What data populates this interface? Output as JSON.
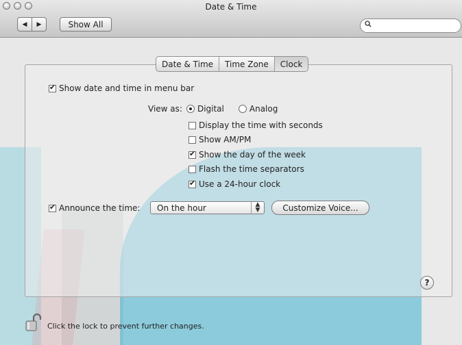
{
  "window": {
    "title": "Date & Time"
  },
  "toolbar": {
    "back_label": "◀",
    "forward_label": "▶",
    "show_all_label": "Show All"
  },
  "search": {
    "value": "",
    "placeholder": ""
  },
  "tabs": [
    {
      "label": "Date & Time",
      "selected": false
    },
    {
      "label": "Time Zone",
      "selected": false
    },
    {
      "label": "Clock",
      "selected": true
    }
  ],
  "clock": {
    "show_in_menu_bar": {
      "label": "Show date and time in menu bar",
      "checked": true
    },
    "view_as": {
      "label": "View as:",
      "options": [
        {
          "label": "Digital",
          "selected": true
        },
        {
          "label": "Analog",
          "selected": false
        }
      ]
    },
    "options": [
      {
        "label": "Display the time with seconds",
        "checked": false
      },
      {
        "label": "Show AM/PM",
        "checked": false
      },
      {
        "label": "Show the day of the week",
        "checked": true
      },
      {
        "label": "Flash the time separators",
        "checked": false
      },
      {
        "label": "Use a 24-hour clock",
        "checked": true
      }
    ],
    "announce": {
      "label": "Announce the time:",
      "checked": true,
      "selected_value": "On the hour",
      "customize_label": "Customize Voice..."
    }
  },
  "help": {
    "label": "?"
  },
  "lock": {
    "text": "Click the lock to prevent further changes."
  },
  "colors": {
    "accent_overlay": "#3fb3cf"
  },
  "icons": {
    "search": "search-icon",
    "lock": "lock-open-icon",
    "help": "help-icon"
  }
}
